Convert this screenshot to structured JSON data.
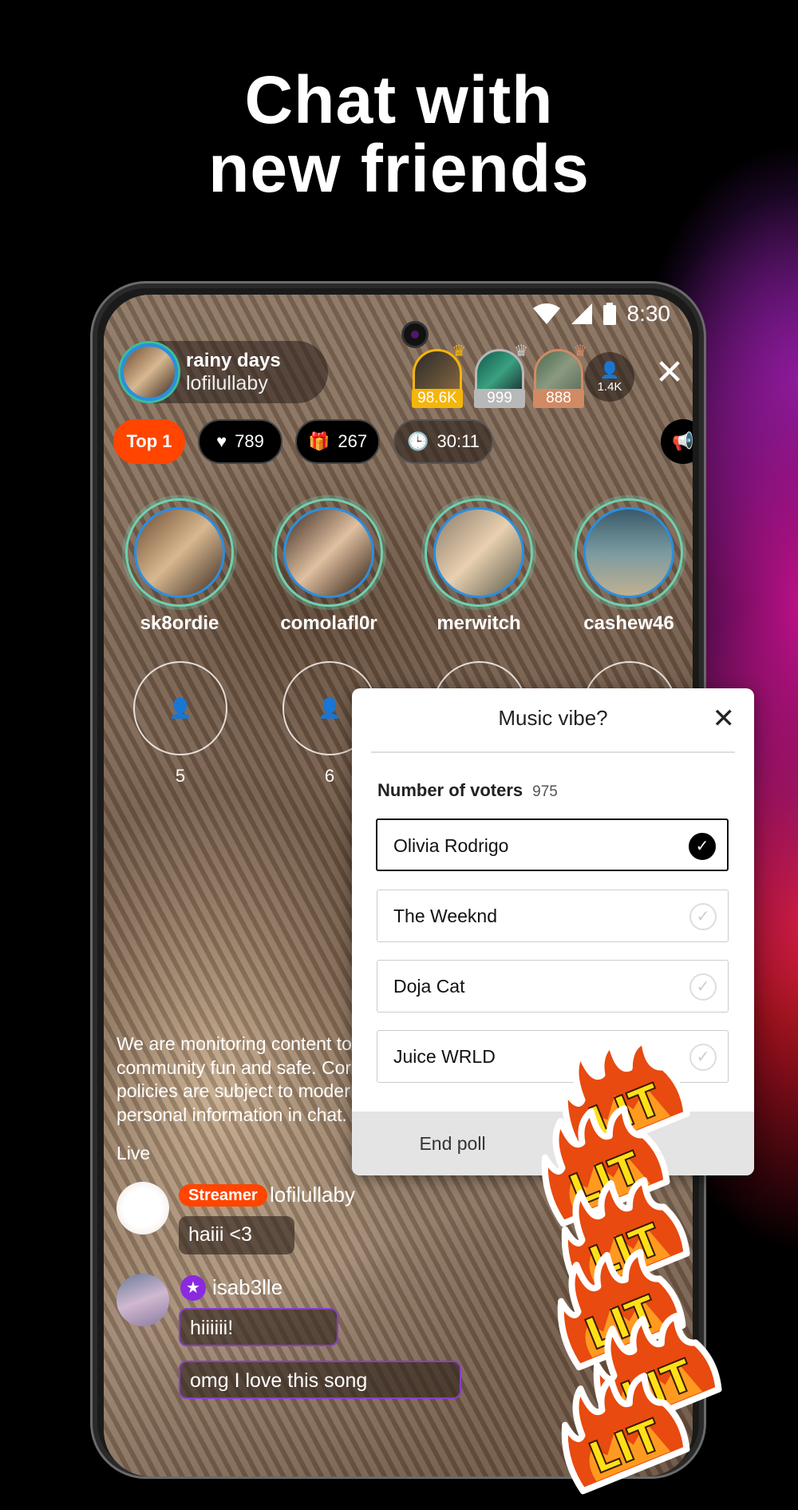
{
  "headline": {
    "line1": "Chat with",
    "line2": "new friends"
  },
  "status_bar": {
    "time": "8:30",
    "icons": [
      "wifi-icon",
      "cellular-icon",
      "battery-icon"
    ]
  },
  "host": {
    "title": "rainy days",
    "handle": "lofilullaby"
  },
  "top_viewers": [
    {
      "count": "98.6K",
      "color": "#f5b50a"
    },
    {
      "count": "999",
      "color": "#b8b8b8"
    },
    {
      "count": "888",
      "color": "#d08a64"
    }
  ],
  "viewer_total": "1.4K",
  "stats": {
    "rank": "Top 1",
    "likes": "789",
    "gifts": "267",
    "duration": "30:11"
  },
  "guests": [
    {
      "name": "sk8ordie"
    },
    {
      "name": "comolafl0r"
    },
    {
      "name": "merwitch"
    },
    {
      "name": "cashew46"
    }
  ],
  "empty_seats": [
    "5",
    "6"
  ],
  "notice": {
    "lines": [
      "We are monitoring content to",
      "community fun and safe. Cor",
      "policies are subject to moder",
      "personal information in chat."
    ]
  },
  "live_label": "Live",
  "chat": [
    {
      "user": "lofilullaby",
      "badge": "Streamer",
      "messages": [
        "haiii <3"
      ]
    },
    {
      "user": "isab3lle",
      "badge_icon": "star-icon",
      "messages": [
        "hiiiiii!",
        "omg I love this song"
      ]
    }
  ],
  "poll": {
    "title": "Music vibe?",
    "voters_label": "Number of voters",
    "voters_count": "975",
    "options": [
      {
        "label": "Olivia Rodrigo",
        "selected": true
      },
      {
        "label": "The Weeknd",
        "selected": false
      },
      {
        "label": "Doja Cat",
        "selected": false
      },
      {
        "label": "Juice WRLD",
        "selected": false
      }
    ],
    "end_label": "End poll"
  },
  "sticker_text": "LIT",
  "colors": {
    "accent": "#ff4500",
    "purple": "#8a3cd0",
    "seat_ring": "#6fd0b0"
  }
}
